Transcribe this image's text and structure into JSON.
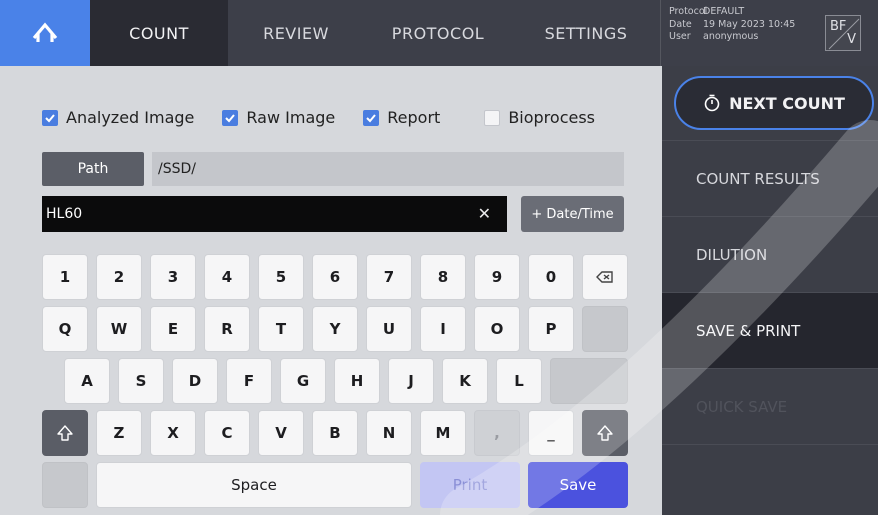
{
  "nav": {
    "tabs": [
      {
        "label": "COUNT"
      },
      {
        "label": "REVIEW"
      },
      {
        "label": "PROTOCOL"
      },
      {
        "label": "SETTINGS"
      }
    ]
  },
  "info": {
    "protocol_label": "Protocol",
    "protocol_value": "DEFAULT",
    "date_label": "Date",
    "date_value": "19 May 2023 10:45",
    "user_label": "User",
    "user_value": "anonymous"
  },
  "mode": {
    "top": "BF",
    "bottom": "V"
  },
  "options": [
    {
      "label": "Analyzed Image",
      "checked": true
    },
    {
      "label": "Raw Image",
      "checked": true
    },
    {
      "label": "Report",
      "checked": true
    },
    {
      "label": "Bioprocess",
      "checked": false
    }
  ],
  "path": {
    "button_label": "Path",
    "value": "/SSD/"
  },
  "filename": {
    "value": "HL60",
    "clear_glyph": "✕",
    "datetime_label": "+ Date/Time"
  },
  "keyboard": {
    "row1": [
      "1",
      "2",
      "3",
      "4",
      "5",
      "6",
      "7",
      "8",
      "9",
      "0"
    ],
    "row2": [
      "Q",
      "W",
      "E",
      "R",
      "T",
      "Y",
      "U",
      "I",
      "O",
      "P"
    ],
    "row3": [
      "A",
      "S",
      "D",
      "F",
      "G",
      "H",
      "J",
      "K",
      "L"
    ],
    "row4": [
      "Z",
      "X",
      "C",
      "V",
      "B",
      "N",
      "M",
      ",",
      "_"
    ],
    "space_label": "Space",
    "print_label": "Print",
    "save_label": "Save"
  },
  "side": {
    "next_count": "NEXT COUNT",
    "items": [
      {
        "label": "COUNT RESULTS"
      },
      {
        "label": "DILUTION"
      },
      {
        "label": "SAVE & PRINT"
      },
      {
        "label": "QUICK SAVE"
      }
    ]
  },
  "colors": {
    "accent": "#4a82e8",
    "save": "#4b52de",
    "check": "#4a7de0"
  }
}
